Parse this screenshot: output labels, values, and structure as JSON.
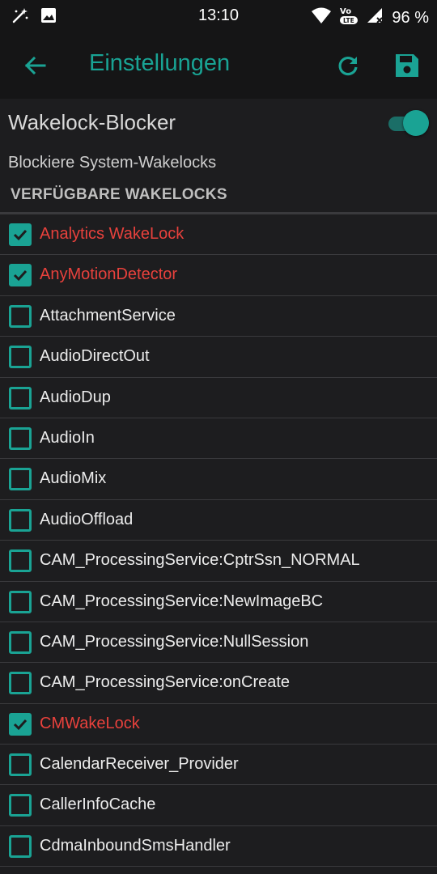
{
  "status_bar": {
    "time": "13:10",
    "battery": "96 %",
    "network": "VoLTE"
  },
  "toolbar": {
    "title": "Einstellungen"
  },
  "main_toggle": {
    "label": "Wakelock-Blocker",
    "enabled": true
  },
  "subtitle": "Blockiere System-Wakelocks",
  "section_header": "VERFÜGBARE WAKELOCKS",
  "colors": {
    "accent": "#1aa394",
    "blocked_text": "#e8413c",
    "background": "#1d1d1f"
  },
  "wakelocks": [
    {
      "label": "Analytics WakeLock",
      "checked": true
    },
    {
      "label": "AnyMotionDetector",
      "checked": true
    },
    {
      "label": "AttachmentService",
      "checked": false
    },
    {
      "label": "AudioDirectOut",
      "checked": false
    },
    {
      "label": "AudioDup",
      "checked": false
    },
    {
      "label": "AudioIn",
      "checked": false
    },
    {
      "label": "AudioMix",
      "checked": false
    },
    {
      "label": "AudioOffload",
      "checked": false
    },
    {
      "label": "CAM_ProcessingService:CptrSsn_NORMAL",
      "checked": false
    },
    {
      "label": "CAM_ProcessingService:NewImageBC",
      "checked": false
    },
    {
      "label": "CAM_ProcessingService:NullSession",
      "checked": false
    },
    {
      "label": "CAM_ProcessingService:onCreate",
      "checked": false
    },
    {
      "label": "CMWakeLock",
      "checked": true
    },
    {
      "label": "CalendarReceiver_Provider",
      "checked": false
    },
    {
      "label": "CallerInfoCache",
      "checked": false
    },
    {
      "label": "CdmaInboundSmsHandler",
      "checked": false
    }
  ]
}
